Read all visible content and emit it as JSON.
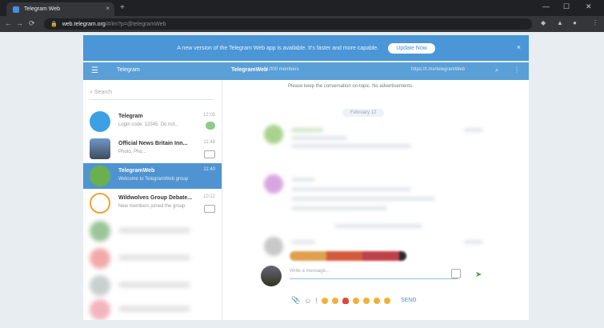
{
  "browser": {
    "tab_title": "Telegram Web",
    "url_host": "web.telegram.org",
    "url_path": "/#/im?p=@telegramWeb",
    "new_tab": "+",
    "tab_close": "×",
    "back": "←",
    "forward": "→",
    "reload": "⟳",
    "lock": "🔒",
    "minimize": "—",
    "maximize": "☐",
    "close": "✕",
    "menu": "⋮"
  },
  "banner": {
    "text": "A new version of the Telegram Web app is available. It's faster and more capable.",
    "button": "Update Now",
    "close": "×"
  },
  "header": {
    "menu_icon": "☰",
    "app_name": "Telegram",
    "chat_title": "TelegramWeb",
    "members": "4,000 members",
    "link": "https://t.me/telegramWeb",
    "search_icon": "⌕",
    "more_icon": "⋮"
  },
  "sidebar": {
    "search_placeholder": "Search",
    "dialogs": [
      {
        "name": "Telegram",
        "preview": "Login code: 12345. Do not...",
        "time": "12:05",
        "avatar_color": "#3ea0e4",
        "indicator": "badge",
        "active": false
      },
      {
        "name": "Official News Britain Inn...",
        "preview": "Photo, Pho...",
        "time": "11:48",
        "avatar_color": "#6f97c9",
        "indicator": "mute",
        "active": false
      },
      {
        "name": "TelegramWeb",
        "preview": "Welcome to TelegramWeb group",
        "time": "11:40",
        "avatar_color": "#6ab04c",
        "indicator": "none",
        "active": true
      },
      {
        "name": "Wildwolves Group Debate...",
        "preview": "New members joined the group",
        "time": "10:12",
        "avatar_color": "#f0a232",
        "indicator": "mute",
        "active": false
      }
    ],
    "blurred_avatar_colors": [
      "#9cc59a",
      "#f2a9aa",
      "#c9cfcf",
      "#f2b5c0"
    ]
  },
  "chat": {
    "pinned_text": "Please keep the conversation on-topic. No advertisements.",
    "date_divider": "February 12",
    "compose_placeholder": "Write a message...",
    "send_icon": "➤",
    "send_label": "SEND",
    "reaction_colors": [
      "#e0a050",
      "#d25a3c",
      "#c0404a",
      "#2a2a2a"
    ],
    "message_avatar_colors": [
      "#a8d38c",
      "#d7a6e0",
      "#c8c8c8"
    ],
    "toolbar_icons": [
      "📎",
      "☺",
      "!"
    ]
  }
}
